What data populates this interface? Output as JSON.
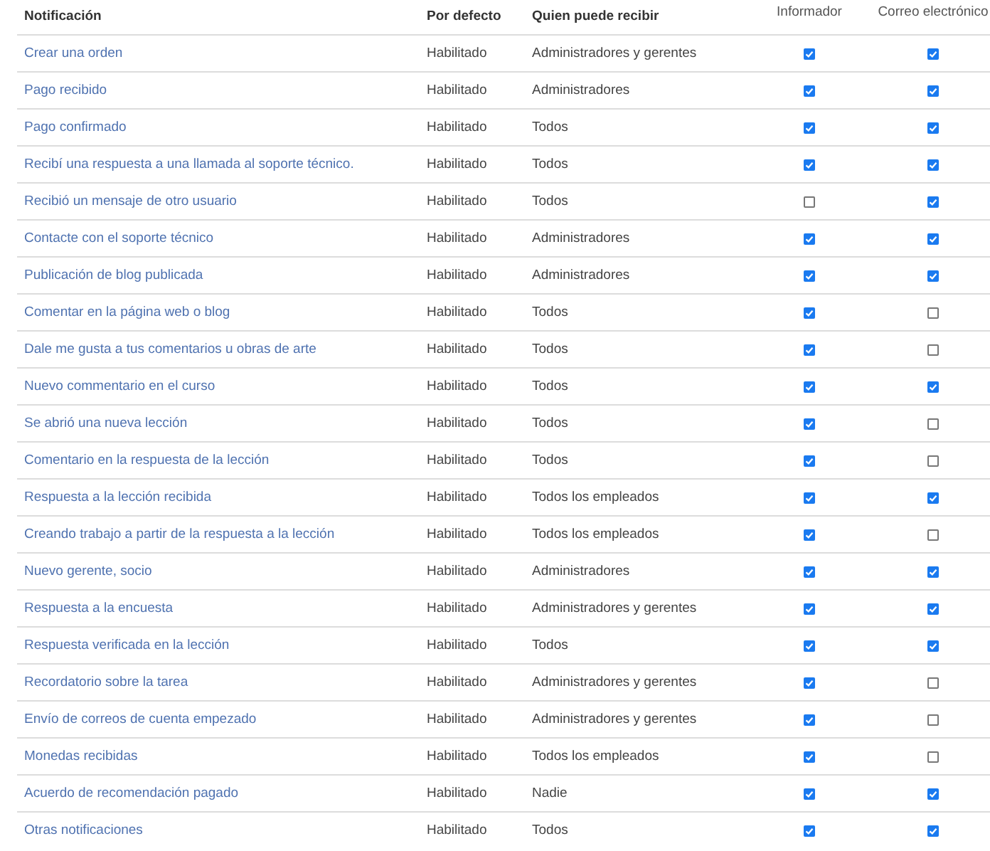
{
  "columns": [
    "Notificación",
    "Por defecto",
    "Quien puede recibir",
    "Informador",
    "Correo electrónico"
  ],
  "rows": [
    {
      "name": "Crear una orden",
      "default": "Habilitado",
      "recipients": "Administradores y gerentes",
      "informer": true,
      "email": true
    },
    {
      "name": "Pago recibido",
      "default": "Habilitado",
      "recipients": "Administradores",
      "informer": true,
      "email": true
    },
    {
      "name": "Pago confirmado",
      "default": "Habilitado",
      "recipients": "Todos",
      "informer": true,
      "email": true
    },
    {
      "name": "Recibí una respuesta a una llamada al soporte técnico.",
      "default": "Habilitado",
      "recipients": "Todos",
      "informer": true,
      "email": true
    },
    {
      "name": "Recibió un mensaje de otro usuario",
      "default": "Habilitado",
      "recipients": "Todos",
      "informer": false,
      "email": true
    },
    {
      "name": "Contacte con el soporte técnico",
      "default": "Habilitado",
      "recipients": "Administradores",
      "informer": true,
      "email": true
    },
    {
      "name": "Publicación de blog publicada",
      "default": "Habilitado",
      "recipients": "Administradores",
      "informer": true,
      "email": true
    },
    {
      "name": "Comentar en la página web o blog",
      "default": "Habilitado",
      "recipients": "Todos",
      "informer": true,
      "email": false
    },
    {
      "name": "Dale me gusta a tus comentarios u obras de arte",
      "default": "Habilitado",
      "recipients": "Todos",
      "informer": true,
      "email": false
    },
    {
      "name": "Nuevo commentario en el curso",
      "default": "Habilitado",
      "recipients": "Todos",
      "informer": true,
      "email": true
    },
    {
      "name": "Se abrió una nueva lección",
      "default": "Habilitado",
      "recipients": "Todos",
      "informer": true,
      "email": false
    },
    {
      "name": "Comentario en la respuesta de la lección",
      "default": "Habilitado",
      "recipients": "Todos",
      "informer": true,
      "email": false
    },
    {
      "name": "Respuesta a la lección recibida",
      "default": "Habilitado",
      "recipients": "Todos los empleados",
      "informer": true,
      "email": true
    },
    {
      "name": "Creando trabajo a partir de la respuesta a la lección",
      "default": "Habilitado",
      "recipients": "Todos los empleados",
      "informer": true,
      "email": false
    },
    {
      "name": "Nuevo gerente, socio",
      "default": "Habilitado",
      "recipients": "Administradores",
      "informer": true,
      "email": true
    },
    {
      "name": "Respuesta a la encuesta",
      "default": "Habilitado",
      "recipients": "Administradores y gerentes",
      "informer": true,
      "email": true
    },
    {
      "name": "Respuesta verificada en la lección",
      "default": "Habilitado",
      "recipients": "Todos",
      "informer": true,
      "email": true
    },
    {
      "name": "Recordatorio sobre la tarea",
      "default": "Habilitado",
      "recipients": "Administradores y gerentes",
      "informer": true,
      "email": false
    },
    {
      "name": "Envío de correos de cuenta empezado",
      "default": "Habilitado",
      "recipients": "Administradores y gerentes",
      "informer": true,
      "email": false
    },
    {
      "name": "Monedas recibidas",
      "default": "Habilitado",
      "recipients": "Todos los empleados",
      "informer": true,
      "email": false
    },
    {
      "name": "Acuerdo de recomendación pagado",
      "default": "Habilitado",
      "recipients": "Nadie",
      "informer": true,
      "email": true
    },
    {
      "name": "Otras notificaciones",
      "default": "Habilitado",
      "recipients": "Todos",
      "informer": true,
      "email": true
    }
  ]
}
